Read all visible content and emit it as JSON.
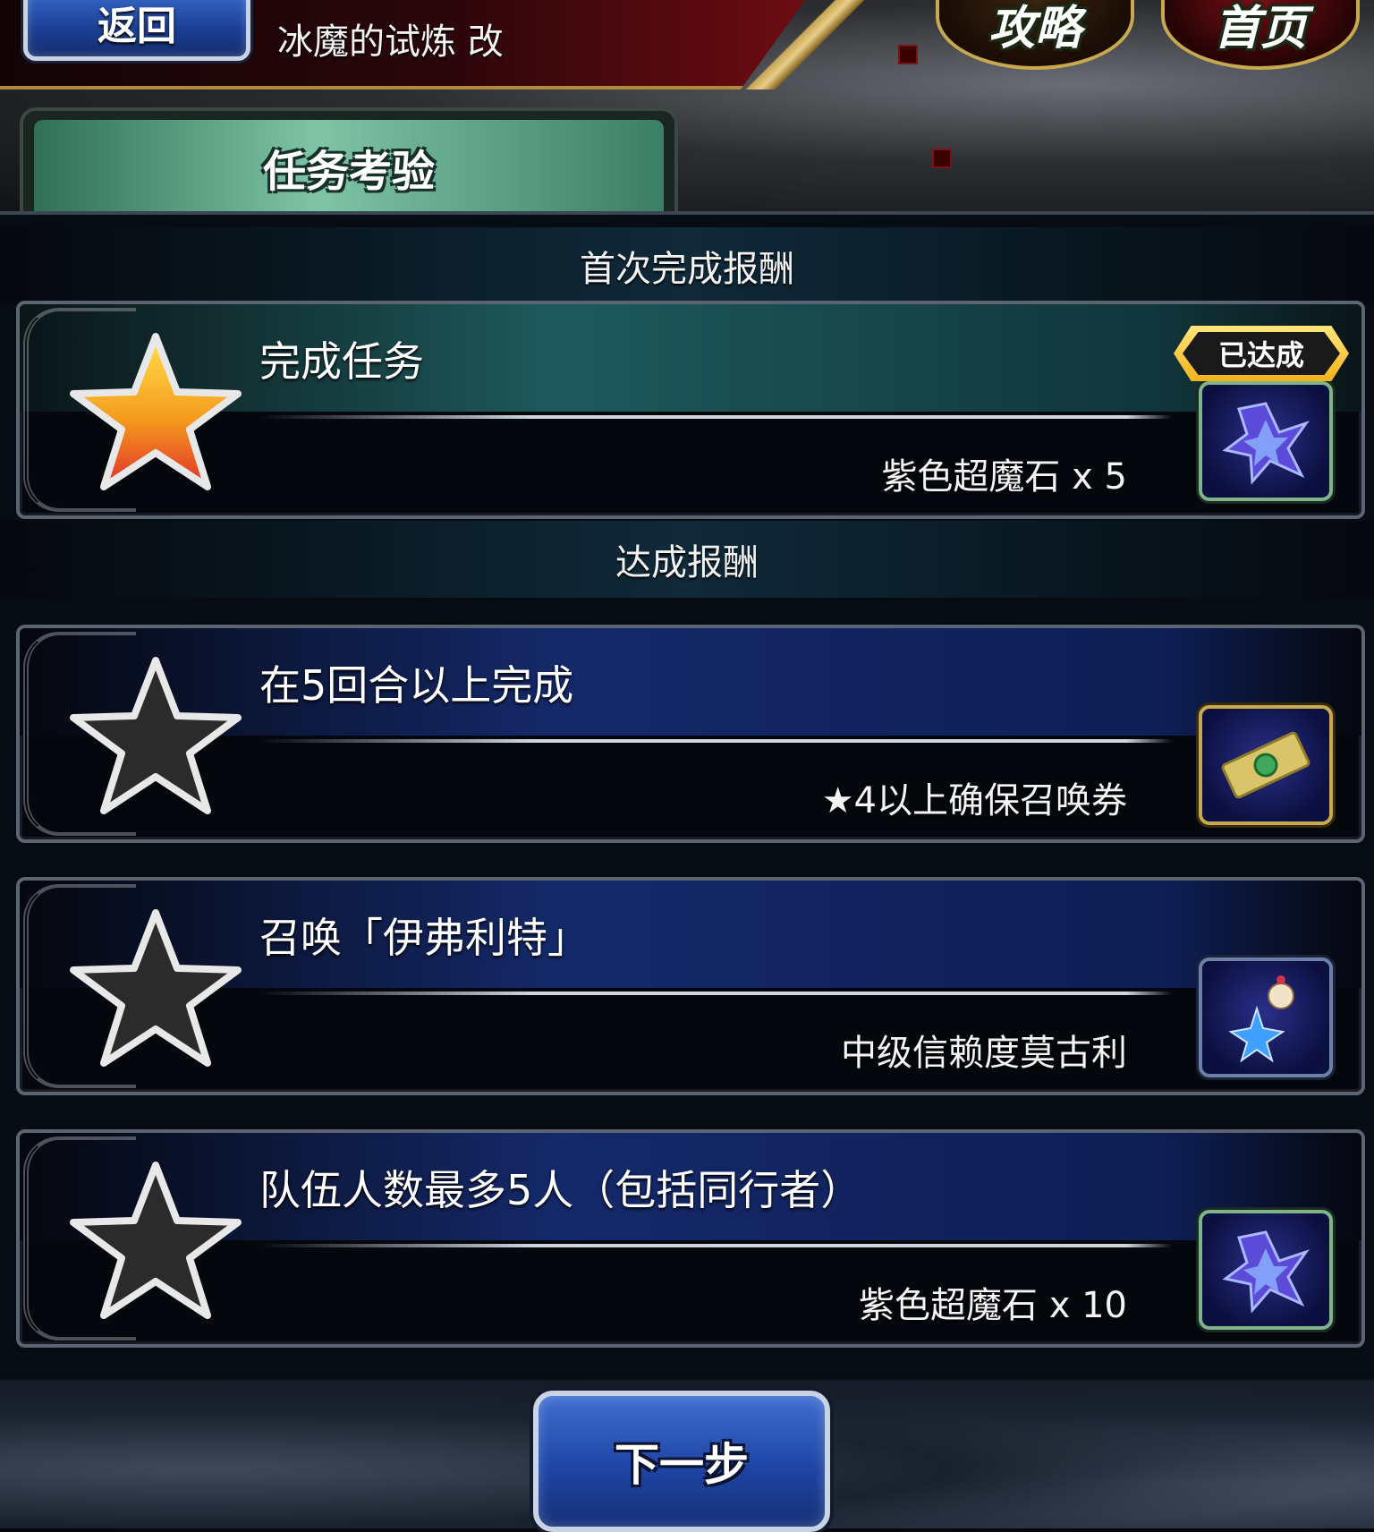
{
  "header": {
    "back_label": "返回",
    "stage_title": "冰魔的试炼 改",
    "guide_label": "攻略",
    "home_label": "首页"
  },
  "tab": {
    "label": "任务考验"
  },
  "sections": {
    "first_clear": "首次完成报酬",
    "achievement": "达成报酬"
  },
  "missions": [
    {
      "title": "完成任务",
      "reward": "紫色超魔石 x 5",
      "status": "已达成",
      "achieved": true,
      "reward_icon": "purple-magicite-icon"
    },
    {
      "title": "在5回合以上完成",
      "reward": "★4以上确保召唤券",
      "achieved": false,
      "reward_icon": "summon-ticket-icon"
    },
    {
      "title": "召唤「伊弗利特」",
      "reward": "中级信赖度莫古利",
      "achieved": false,
      "reward_icon": "trust-moogle-icon"
    },
    {
      "title": "队伍人数最多5人（包括同行者）",
      "reward": "紫色超魔石 x 10",
      "achieved": false,
      "reward_icon": "purple-magicite-icon"
    }
  ],
  "footer": {
    "next_label": "下一步"
  },
  "colors": {
    "achieved_star": "#f5a623",
    "locked_star": "#2b2b2b",
    "badge_gold": "#f2c12a"
  }
}
